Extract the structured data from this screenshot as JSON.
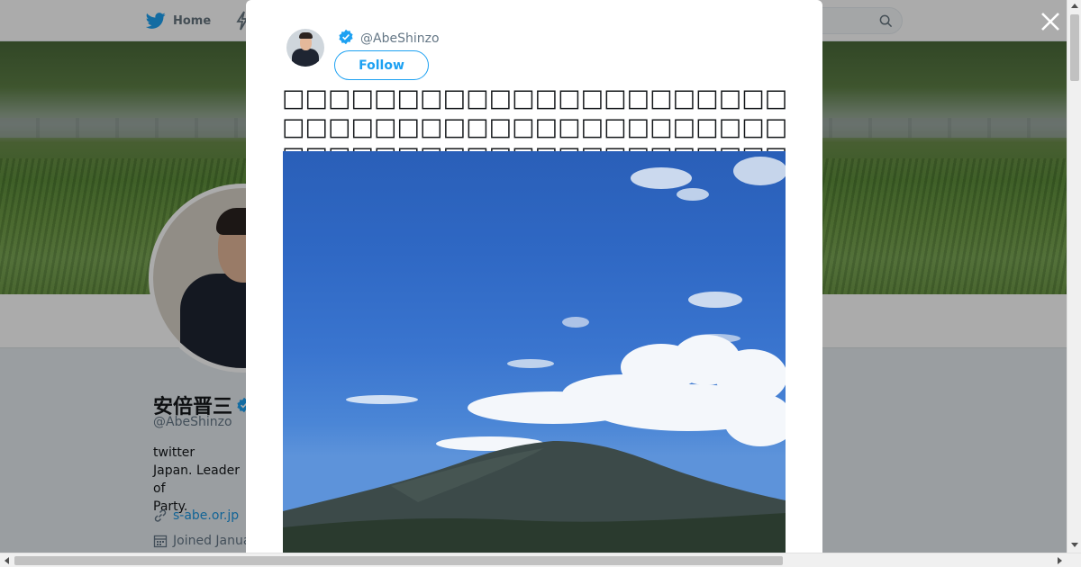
{
  "nav": {
    "home_label": "Home",
    "home_icon": "twitter-bird-icon",
    "moments_icon": "lightning-icon",
    "search_icon": "search-icon"
  },
  "profile": {
    "name": "安倍晋三",
    "handle": "@AbeShinzo",
    "bio": "twitter\nJapan. Leader of\nParty.",
    "link": "s-abe.or.jp",
    "joined": "Joined January"
  },
  "tweet": {
    "handle": "@AbeShinzo",
    "follow_label": "Follow",
    "text": "□□□□□□□□□□□□□□□□□□□□□□□□□□□□□□□□□□□□□□□□□□□□□□□□□□□□□□□□□□□□□□□□□□□□□□□□□□□□□",
    "image_subject": "mountain-under-blue-sky"
  },
  "colors": {
    "accent": "#1da1f2",
    "link": "#1b95e0",
    "muted": "#657786",
    "overlay": "rgba(0,0,0,0.33)"
  }
}
